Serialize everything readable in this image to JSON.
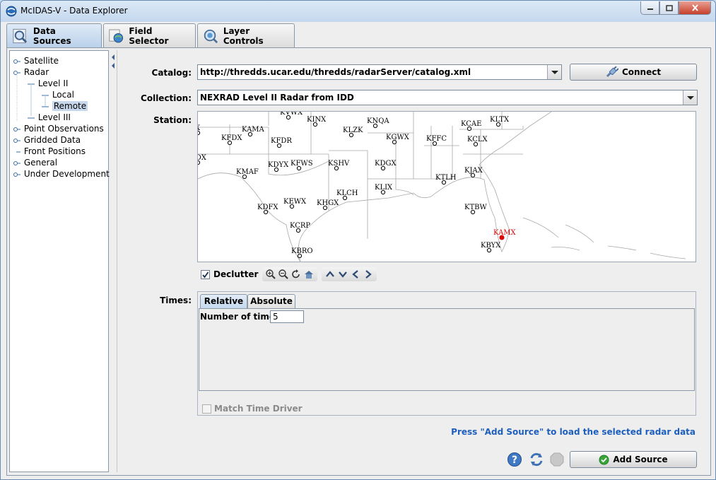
{
  "window": {
    "title": "McIDAS-V - Data Explorer"
  },
  "main_tabs": [
    {
      "label": "Data Sources",
      "active": true
    },
    {
      "label": "Field Selector",
      "active": false
    },
    {
      "label": "Layer Controls",
      "active": false
    }
  ],
  "tree": [
    {
      "label": "Satellite",
      "level": 0,
      "expandable": true
    },
    {
      "label": "Radar",
      "level": 0,
      "expandable": true
    },
    {
      "label": "Level II",
      "level": 1,
      "expandable": true
    },
    {
      "label": "Local",
      "level": 2,
      "expandable": false
    },
    {
      "label": "Remote",
      "level": 2,
      "expandable": false,
      "selected": true
    },
    {
      "label": "Level III",
      "level": 1,
      "expandable": false
    },
    {
      "label": "Point Observations",
      "level": 0,
      "expandable": true
    },
    {
      "label": "Gridded Data",
      "level": 0,
      "expandable": true
    },
    {
      "label": "Front Positions",
      "level": 0,
      "expandable": false
    },
    {
      "label": "General",
      "level": 0,
      "expandable": true
    },
    {
      "label": "Under Development",
      "level": 0,
      "expandable": true
    }
  ],
  "form": {
    "catalog_label": "Catalog:",
    "catalog_value": "http://thredds.ucar.edu/thredds/radarServer/catalog.xml",
    "connect_label": "Connect",
    "collection_label": "Collection:",
    "collection_value": "NEXRAD Level II Radar from IDD",
    "station_label": "Station:",
    "declutter_label": "Declutter",
    "declutter_checked": true,
    "times_label": "Times:",
    "times_tabs": [
      {
        "label": "Relative",
        "active": true
      },
      {
        "label": "Absolute",
        "active": false
      }
    ],
    "num_times_label": "Number of times:",
    "num_times_value": "5",
    "match_time_label": "Match Time Driver",
    "match_time_checked": false,
    "hint": "Press \"Add Source\" to load the selected radar data",
    "add_source_label": "Add Source"
  },
  "stations": [
    {
      "id": "KVWX",
      "selected": false
    },
    {
      "id": "KINX",
      "selected": false
    },
    {
      "id": "KNQA",
      "selected": false
    },
    {
      "id": "KLTX",
      "selected": false
    },
    {
      "id": "GX",
      "selected": false
    },
    {
      "id": "KFDX",
      "selected": false
    },
    {
      "id": "KAMA",
      "selected": false
    },
    {
      "id": "KLZK",
      "selected": false
    },
    {
      "id": "KCAE",
      "selected": false
    },
    {
      "id": "KGWX",
      "selected": false
    },
    {
      "id": "KFFC",
      "selected": false
    },
    {
      "id": "KCLX",
      "selected": false
    },
    {
      "id": "KFDR",
      "selected": false
    },
    {
      "id": "HDX",
      "selected": false
    },
    {
      "id": "KDYX",
      "selected": false
    },
    {
      "id": "KFWS",
      "selected": false
    },
    {
      "id": "KSHV",
      "selected": false
    },
    {
      "id": "KDGX",
      "selected": false
    },
    {
      "id": "KJAX",
      "selected": false
    },
    {
      "id": "KMAF",
      "selected": false
    },
    {
      "id": "KTLH",
      "selected": false
    },
    {
      "id": "KLCH",
      "selected": false
    },
    {
      "id": "KLIX",
      "selected": false
    },
    {
      "id": "KEWX",
      "selected": false
    },
    {
      "id": "KHGX",
      "selected": false
    },
    {
      "id": "KDFX",
      "selected": false
    },
    {
      "id": "KTBW",
      "selected": false
    },
    {
      "id": "KCRP",
      "selected": false
    },
    {
      "id": "KAMX",
      "selected": true
    },
    {
      "id": "KBYX",
      "selected": false
    },
    {
      "id": "KBRO",
      "selected": false
    }
  ],
  "colors": {
    "accent": "#1e5fbd",
    "selected_station": "#e00000",
    "tab_active": "#c4d8ee"
  }
}
